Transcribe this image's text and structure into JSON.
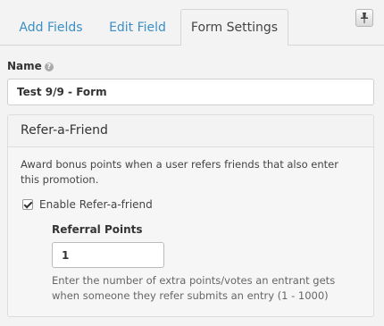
{
  "tabs": [
    {
      "label": "Add Fields",
      "active": false
    },
    {
      "label": "Edit Field",
      "active": false
    },
    {
      "label": "Form Settings",
      "active": true
    }
  ],
  "icons": {
    "pin": "pin-icon",
    "help": "help-icon",
    "checkmark": "checkmark-icon"
  },
  "name_field": {
    "label": "Name",
    "help_glyph": "?",
    "value": "Test 9/9 - Form"
  },
  "refer_panel": {
    "title": "Refer-a-Friend",
    "description": "Award bonus points when a user refers friends that also enter this promotion.",
    "enable_checkbox": {
      "label": "Enable Refer-a-friend",
      "checked": true
    },
    "referral_points": {
      "label": "Referral Points",
      "value": "1",
      "help": "Enter the number of extra points/votes an entrant gets when someone they refer submits an entry (1 - 1000)"
    }
  },
  "colors": {
    "link": "#3b8fc6",
    "background": "#f3f3f3"
  }
}
